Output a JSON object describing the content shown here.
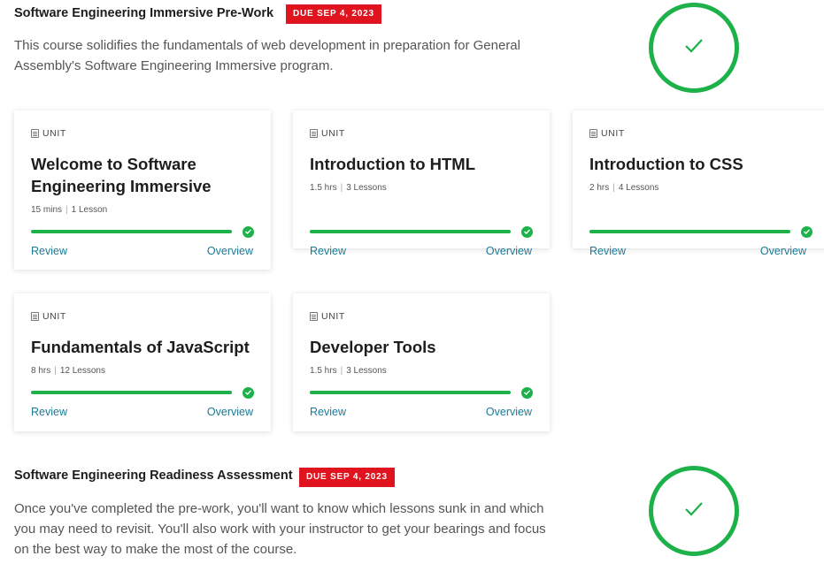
{
  "sections": [
    {
      "title": "Software Engineering Immersive Pre-Work",
      "due": "DUE SEP 4, 2023",
      "description": "This course solidifies the fundamentals of web development in preparation for General Assembly's Software Engineering Immersive program.",
      "status_icon": "check-icon"
    },
    {
      "title": "Software Engineering Readiness Assessment",
      "due": "DUE SEP 4, 2023",
      "description": "Once you've completed the pre-work, you'll want to know which lessons sunk in and which you may need to revisit. You'll also work with your instructor to get your bearings and focus on the best way to make the most of the course.",
      "status_icon": "check-icon"
    }
  ],
  "units": [
    {
      "label": "UNIT",
      "title": "Welcome to Software Engineering Immersive",
      "duration": "15 mins",
      "lessons": "1 Lesson",
      "progress": 1.0,
      "review": "Review",
      "overview": "Overview"
    },
    {
      "label": "UNIT",
      "title": "Introduction to HTML",
      "duration": "1.5 hrs",
      "lessons": "3 Lessons",
      "progress": 1.0,
      "review": "Review",
      "overview": "Overview"
    },
    {
      "label": "UNIT",
      "title": "Introduction to CSS",
      "duration": "2 hrs",
      "lessons": "4 Lessons",
      "progress": 1.0,
      "review": "Review",
      "overview": "Overview"
    },
    {
      "label": "UNIT",
      "title": "Fundamentals of JavaScript",
      "duration": "8 hrs",
      "lessons": "12 Lessons",
      "progress": 1.0,
      "review": "Review",
      "overview": "Overview"
    },
    {
      "label": "UNIT",
      "title": "Developer Tools",
      "duration": "1.5 hrs",
      "lessons": "3 Lessons",
      "progress": 1.0,
      "review": "Review",
      "overview": "Overview"
    }
  ],
  "colors": {
    "accent": "#1db249",
    "badge": "#e0141e",
    "link": "#1a7a95"
  }
}
